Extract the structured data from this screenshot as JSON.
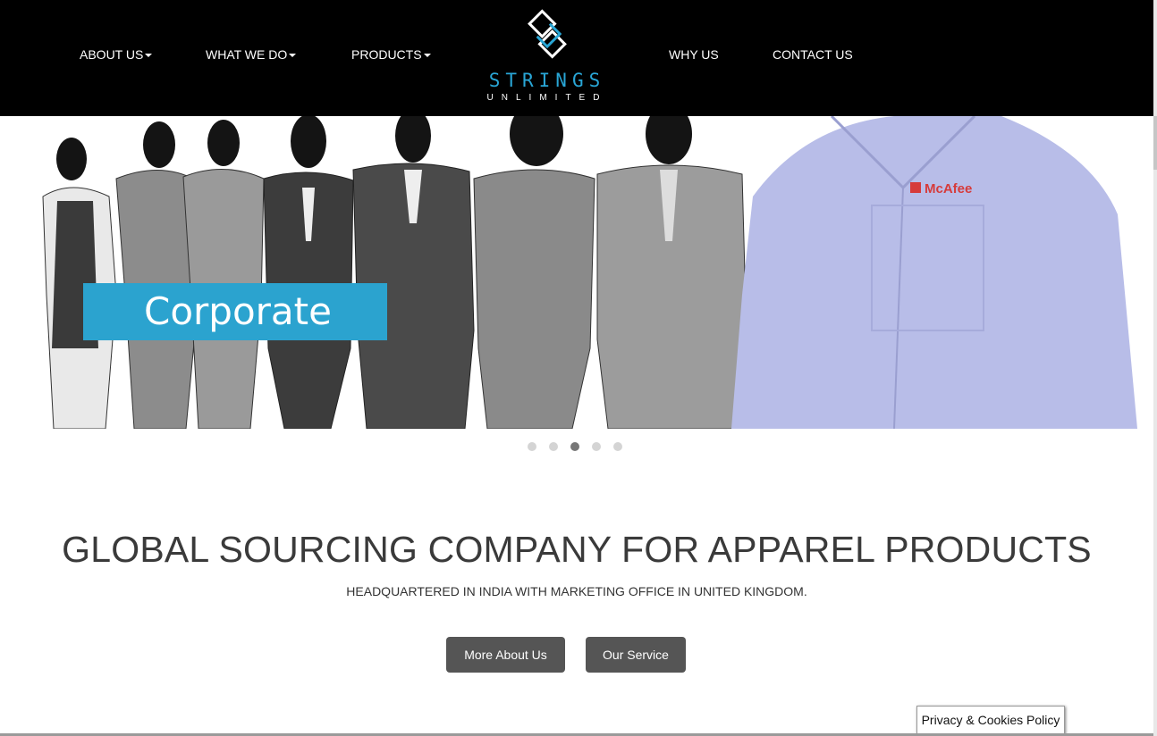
{
  "nav": {
    "about": "ABOUT US",
    "what_we_do": "WHAT WE DO",
    "products": "PRODUCTS",
    "why_us": "WHY US",
    "contact": "CONTACT US"
  },
  "logo": {
    "word": "STRINGS",
    "sub": "UNLIMITED",
    "accent": "#29a6d6"
  },
  "hero": {
    "caption": "Corporate",
    "slide_count": 5,
    "active_slide": 3
  },
  "main": {
    "headline": "GLOBAL SOURCING COMPANY FOR APPAREL PRODUCTS",
    "subline": "HEADQUARTERED IN INDIA WITH MARKETING OFFICE IN UNITED KINGDOM.",
    "btn_about": "More About Us",
    "btn_service": "Our Service"
  },
  "footer": {
    "privacy": "Privacy & Cookies Policy"
  },
  "colors": {
    "header_bg": "#000000",
    "caption_bg": "#2ba3cf",
    "button_bg": "#555555",
    "shirt": "#b8bde8"
  }
}
